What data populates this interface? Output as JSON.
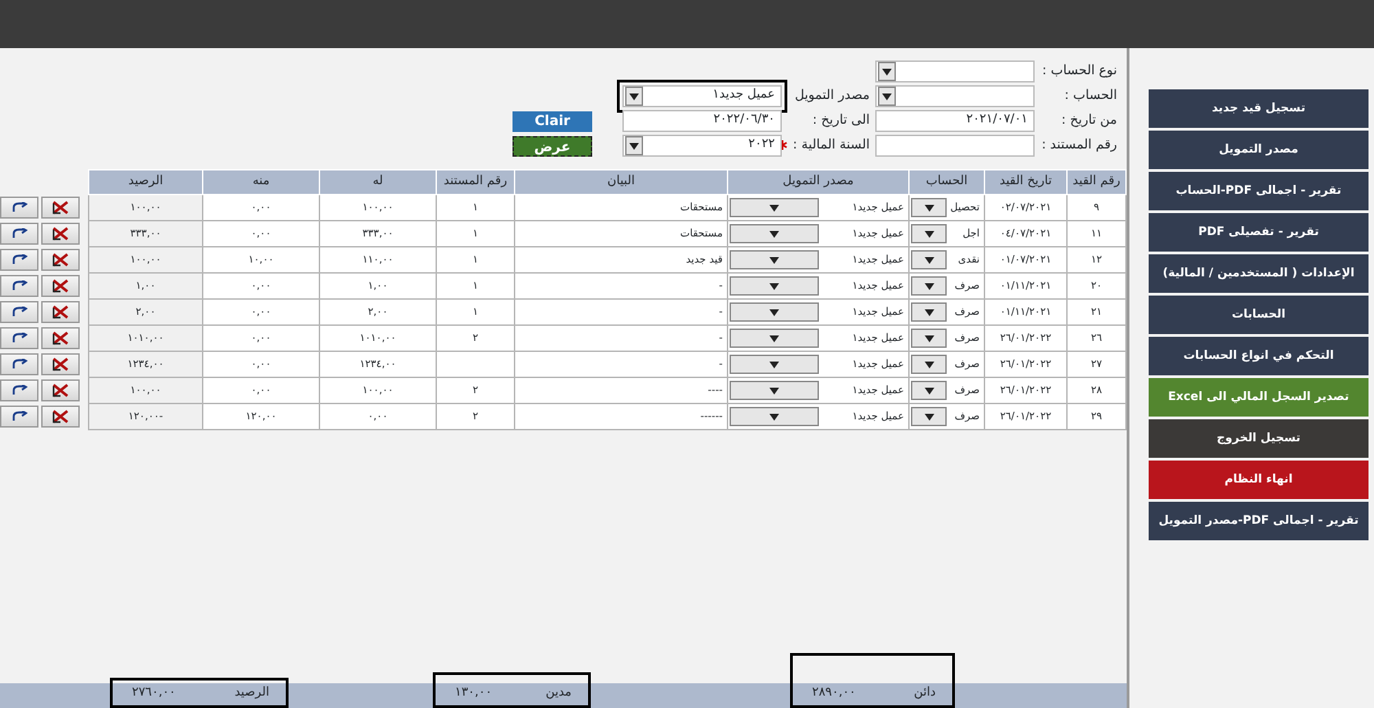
{
  "form": {
    "right_column": [
      {
        "label": "نوع الحساب :",
        "kind": "dropdown",
        "required": false,
        "framed": false
      },
      {
        "label": "الحساب :",
        "kind": "dropdown",
        "required": false,
        "framed": false
      },
      {
        "label": "من تاريخ :",
        "kind": "text",
        "value": "٢٠٢١/٠٧/٠١",
        "required": false,
        "framed": false
      },
      {
        "label": "رقم المستند :",
        "kind": "text",
        "required": false,
        "framed": false
      }
    ],
    "middle_column": [
      {
        "label": "مصدر التمويل",
        "kind": "dropdown",
        "value": "عميل جديد١",
        "required": false,
        "framed": true
      },
      {
        "label": "الى  تاريخ :",
        "kind": "text",
        "value": "٢٠٢٢/٠٦/٣٠",
        "required": false,
        "framed": false
      },
      {
        "label": "السنة المالية :",
        "kind": "dropdown",
        "value": "٢٠٢٢",
        "required": true,
        "framed": false
      }
    ],
    "buttons": [
      {
        "label": "Clair",
        "kind": "clear"
      },
      {
        "label": "عرض",
        "kind": "show"
      }
    ]
  },
  "table": {
    "columns": [
      "رقم القيد",
      "تاريخ القيد",
      "الحساب",
      "مصدر التمويل",
      "البيان",
      "رقم المستند",
      "له",
      "منه",
      "الرصيد"
    ],
    "rows": [
      {
        "cells": [
          "٩",
          "٠٢/٠٧/٢٠٢١",
          "تحصيل",
          "عميل جديد١",
          "مستحقات",
          "١",
          "١٠٠,٠٠",
          "٠,٠٠",
          "١٠٠,٠٠"
        ]
      },
      {
        "cells": [
          "١١",
          "٠٤/٠٧/٢٠٢١",
          "اجل",
          "عميل جديد١",
          "مستحقات",
          "١",
          "٣٣٣,٠٠",
          "٠,٠٠",
          "٣٣٣,٠٠"
        ]
      },
      {
        "cells": [
          "١٢",
          "٠١/٠٧/٢٠٢١",
          "نقدى",
          "عميل جديد١",
          "قيد جديد",
          "١",
          "١١٠,٠٠",
          "١٠,٠٠",
          "١٠٠,٠٠"
        ]
      },
      {
        "cells": [
          "٢٠",
          "٠١/١١/٢٠٢١",
          "صرف",
          "عميل جديد١",
          "-",
          "١",
          "١,٠٠",
          "٠,٠٠",
          "١,٠٠"
        ]
      },
      {
        "cells": [
          "٢١",
          "٠١/١١/٢٠٢١",
          "صرف",
          "عميل جديد١",
          "-",
          "١",
          "٢,٠٠",
          "٠,٠٠",
          "٢,٠٠"
        ]
      },
      {
        "cells": [
          "٢٦",
          "٢٦/٠١/٢٠٢٢",
          "صرف",
          "عميل جديد١",
          "-",
          "٢",
          "١٠١٠,٠٠",
          "٠,٠٠",
          "١٠١٠,٠٠"
        ]
      },
      {
        "cells": [
          "٢٧",
          "٢٦/٠١/٢٠٢٢",
          "صرف",
          "عميل جديد١",
          "-",
          null,
          "١٢٣٤,٠٠",
          "٠,٠٠",
          "١٢٣٤,٠٠"
        ]
      },
      {
        "cells": [
          "٢٨",
          "٢٦/٠١/٢٠٢٢",
          "صرف",
          "عميل جديد١",
          "----",
          "٢",
          "١٠٠,٠٠",
          "٠,٠٠",
          "١٠٠,٠٠"
        ]
      },
      {
        "cells": [
          "٢٩",
          "٢٦/٠١/٢٠٢٢",
          "صرف",
          "عميل جديد١",
          "------",
          "٢",
          "٠,٠٠",
          "١٢٠,٠٠",
          "-١٢٠,٠٠"
        ]
      }
    ]
  },
  "totals": [
    {
      "label": "دائن",
      "value": "٢٨٩٠,٠٠"
    },
    {
      "label": "مدين",
      "value": "١٣٠,٠٠"
    },
    {
      "label": "الرصيد",
      "value": "٢٧٦٠,٠٠"
    }
  ],
  "sidebar": {
    "items": [
      {
        "label": "تسجيل قيد جديد",
        "kind": "normal"
      },
      {
        "label": "مصدر التمويل",
        "kind": "normal"
      },
      {
        "label": "تقرير - اجمالى PDF-الحساب",
        "kind": "normal"
      },
      {
        "label": "تقرير - تفصيلى PDF",
        "kind": "normal"
      },
      {
        "label": "الإعدادات ( المستخدمين / المالية)",
        "kind": "normal"
      },
      {
        "label": "الحسابات",
        "kind": "normal"
      },
      {
        "label": "التحكم في انواع الحسابات",
        "kind": "normal"
      },
      {
        "label": "تصدير السجل المالي الى Excel",
        "kind": "export"
      },
      {
        "label": "تسجيل الخروج",
        "kind": "logout"
      },
      {
        "label": "انهاء النظام",
        "kind": "exit"
      },
      {
        "label": "تقرير - اجمالى PDF-مصدر التمويل",
        "kind": "normal"
      }
    ]
  }
}
